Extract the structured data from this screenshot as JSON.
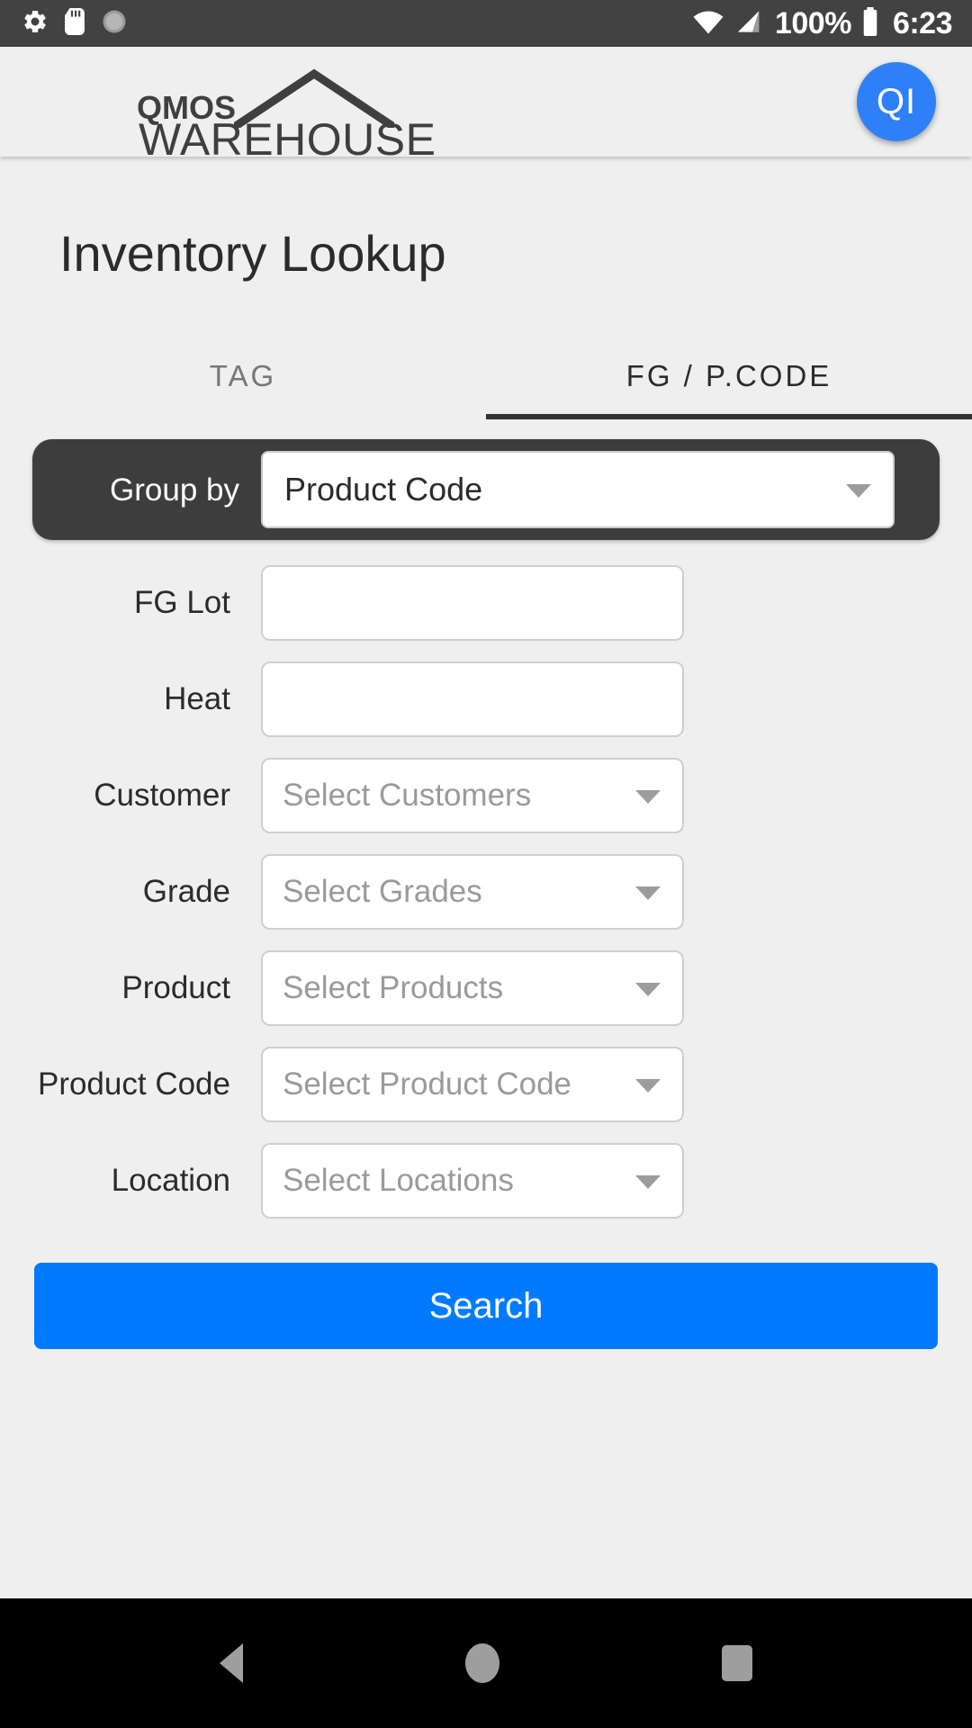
{
  "statusbar": {
    "icons_left": [
      "gear-icon",
      "sd-card-icon",
      "sync-circle-icon"
    ],
    "icons_right": [
      "wifi-icon",
      "cell-signal-icon",
      "battery-icon"
    ],
    "battery_percent": "100%",
    "time": "6:23"
  },
  "appbar": {
    "logo_top": "QMOS",
    "logo_bottom": "WAREHOUSE",
    "avatar_initials": "QI",
    "avatar_color": "#2f80f7"
  },
  "page": {
    "title": "Inventory Lookup"
  },
  "tabs": [
    {
      "label": "TAG",
      "active": false
    },
    {
      "label": "FG / P.CODE",
      "active": true
    }
  ],
  "groupby": {
    "label": "Group by",
    "value": "Product Code",
    "caret": "chevron-down-icon"
  },
  "fields": [
    {
      "label": "FG Lot",
      "type": "text",
      "value": "",
      "placeholder": ""
    },
    {
      "label": "Heat",
      "type": "text",
      "value": "",
      "placeholder": ""
    },
    {
      "label": "Customer",
      "type": "select",
      "value": "",
      "placeholder": "Select Customers"
    },
    {
      "label": "Grade",
      "type": "select",
      "value": "",
      "placeholder": "Select Grades"
    },
    {
      "label": "Product",
      "type": "select",
      "value": "",
      "placeholder": "Select Products"
    },
    {
      "label": "Product Code",
      "type": "select",
      "value": "",
      "placeholder": "Select Product Code"
    },
    {
      "label": "Location",
      "type": "select",
      "value": "",
      "placeholder": "Select Locations"
    }
  ],
  "actions": {
    "search_label": "Search",
    "search_color": "#007bff"
  },
  "navbar": {
    "back": "back-triangle-icon",
    "home": "home-circle-icon",
    "recents": "recents-square-icon"
  }
}
